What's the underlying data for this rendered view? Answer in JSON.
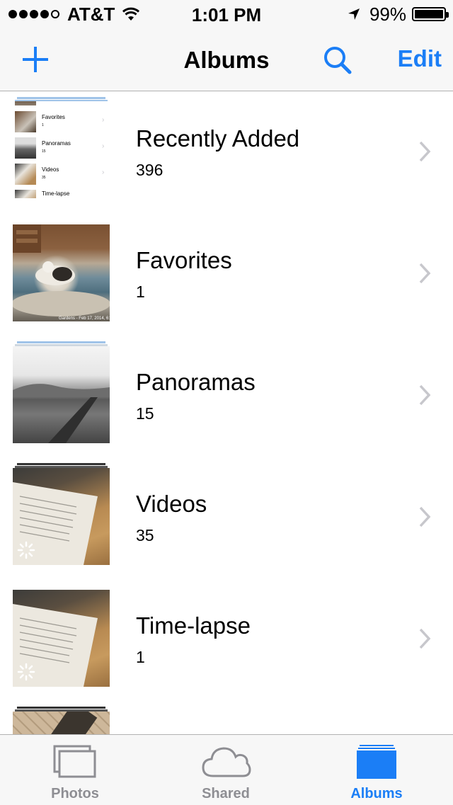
{
  "status_bar": {
    "carrier": "AT&T",
    "time": "1:01 PM",
    "battery_percent": "99%",
    "battery_level": 0.99,
    "signal_bars": 4,
    "icons": [
      "signal-dots-icon",
      "wifi-icon",
      "location-arrow-icon",
      "battery-icon"
    ]
  },
  "nav": {
    "title": "Albums",
    "edit_label": "Edit",
    "accent_color": "#1b7ef6"
  },
  "albums": [
    {
      "name": "Recently Added",
      "count": "396"
    },
    {
      "name": "Favorites",
      "count": "1"
    },
    {
      "name": "Panoramas",
      "count": "15"
    },
    {
      "name": "Videos",
      "count": "35"
    },
    {
      "name": "Time-lapse",
      "count": "1"
    }
  ],
  "recent_thumb_preview": {
    "rows": [
      {
        "label": "Favorites",
        "count": "1"
      },
      {
        "label": "Panoramas",
        "count": "15"
      },
      {
        "label": "Videos",
        "count": "35"
      },
      {
        "label": "Time-lapse",
        "count": ""
      }
    ]
  },
  "favorites_thumb_caption": "Gardens - Feb 17, 2014, 6:",
  "tabs": [
    {
      "label": "Photos",
      "icon": "photos-stack-icon",
      "active": false
    },
    {
      "label": "Shared",
      "icon": "cloud-icon",
      "active": false
    },
    {
      "label": "Albums",
      "icon": "albums-icon",
      "active": true
    }
  ]
}
